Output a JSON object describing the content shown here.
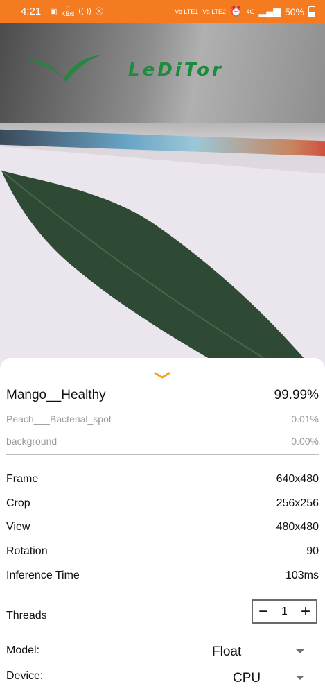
{
  "status_bar": {
    "time": "4:21",
    "data_rate": "0",
    "data_unit": "KB/s",
    "volte1": "Vo LTE1",
    "volte2": "Vo LTE2",
    "network": "4G",
    "battery": "50%"
  },
  "camera": {
    "logo_text": "LeDiTor",
    "logo_color": "#1e8a3b"
  },
  "results": [
    {
      "label": "Mango__Healthy",
      "value": "99.99%"
    },
    {
      "label": "Peach___Bacterial_spot",
      "value": "0.01%"
    },
    {
      "label": "background",
      "value": "0.00%"
    }
  ],
  "info": [
    {
      "label": "Frame",
      "value": "640x480"
    },
    {
      "label": "Crop",
      "value": "256x256"
    },
    {
      "label": "View",
      "value": "480x480"
    },
    {
      "label": "Rotation",
      "value": "90"
    },
    {
      "label": "Inference Time",
      "value": "103ms"
    }
  ],
  "threads": {
    "label": "Threads",
    "value": "1",
    "minus": "−",
    "plus": "+"
  },
  "model": {
    "label": "Model:",
    "value": "Float"
  },
  "device": {
    "label": "Device:",
    "value": "CPU"
  },
  "accent_color": "#f47b20"
}
